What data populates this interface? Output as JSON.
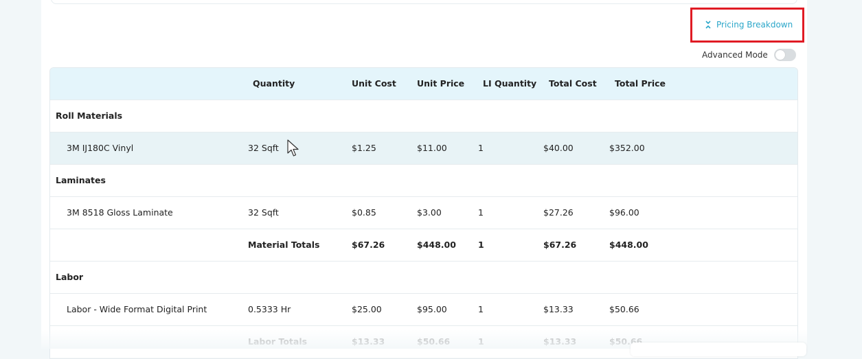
{
  "pricing_breakdown": {
    "label": "Pricing Breakdown",
    "icon": "collapse-chevrons-icon",
    "accent_color": "#2aa6c9"
  },
  "advanced_mode": {
    "label": "Advanced Mode",
    "enabled": false
  },
  "table": {
    "headers": {
      "name": "",
      "quantity": "Quantity",
      "unit_cost": "Unit Cost",
      "unit_price": "Unit Price",
      "li_quantity": "LI Quantity",
      "total_cost": "Total Cost",
      "total_price": "Total Price"
    },
    "roll_materials": {
      "title": "Roll Materials",
      "items": [
        {
          "name": "3M IJ180C Vinyl",
          "quantity": "32 Sqft",
          "unit_cost": "$1.25",
          "unit_price": "$11.00",
          "li_quantity": "1",
          "total_cost": "$40.00",
          "total_price": "$352.00"
        }
      ]
    },
    "laminates": {
      "title": "Laminates",
      "items": [
        {
          "name": "3M 8518 Gloss Laminate",
          "quantity": "32 Sqft",
          "unit_cost": "$0.85",
          "unit_price": "$3.00",
          "li_quantity": "1",
          "total_cost": "$27.26",
          "total_price": "$96.00"
        }
      ]
    },
    "material_totals": {
      "label": "Material Totals",
      "unit_cost": "$67.26",
      "unit_price": "$448.00",
      "li_quantity": "1",
      "total_cost": "$67.26",
      "total_price": "$448.00"
    },
    "labor": {
      "title": "Labor",
      "items": [
        {
          "name": "Labor - Wide Format Digital Print",
          "quantity": "0.5333 Hr",
          "unit_cost": "$25.00",
          "unit_price": "$95.00",
          "li_quantity": "1",
          "total_cost": "$13.33",
          "total_price": "$50.66"
        }
      ]
    },
    "labor_totals": {
      "label": "Labor Totals",
      "unit_cost": "$13.33",
      "unit_price": "$50.66",
      "li_quantity": "1",
      "total_cost": "$13.33",
      "total_price": "$50.66"
    }
  }
}
